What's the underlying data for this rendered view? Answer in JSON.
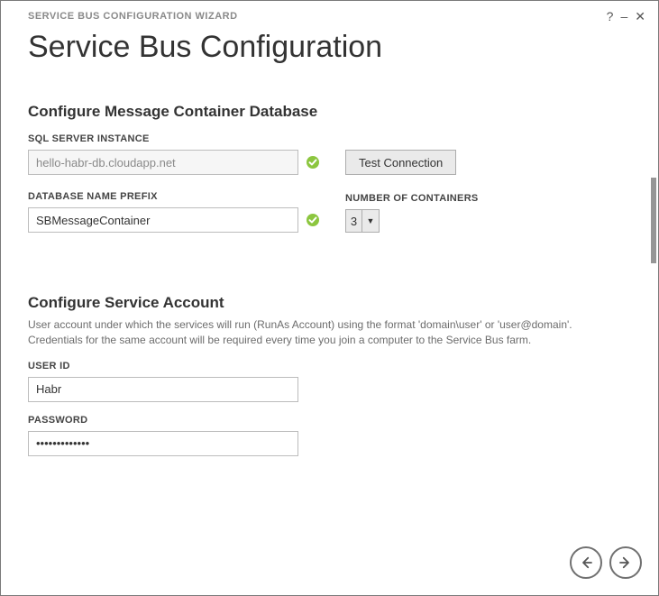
{
  "titlebar": {
    "wizard_title": "SERVICE BUS CONFIGURATION WIZARD"
  },
  "page_title": "Service Bus Configuration",
  "section_db": {
    "heading": "Configure Message Container Database",
    "sql_instance_label": "SQL SERVER INSTANCE",
    "sql_instance_value": "hello-habr-db.cloudapp.net",
    "test_connection_label": "Test Connection",
    "db_prefix_label": "DATABASE NAME PREFIX",
    "db_prefix_value": "SBMessageContainer",
    "num_containers_label": "NUMBER OF CONTAINERS",
    "num_containers_value": "3"
  },
  "section_account": {
    "heading": "Configure Service Account",
    "description": "User account under which the services will run (RunAs Account) using the format 'domain\\user' or 'user@domain'. Credentials for the same account will be required every time you join a computer to the Service Bus farm.",
    "user_id_label": "USER ID",
    "user_id_value": "Habr",
    "password_label": "PASSWORD",
    "password_value": "•••••••••••••"
  }
}
